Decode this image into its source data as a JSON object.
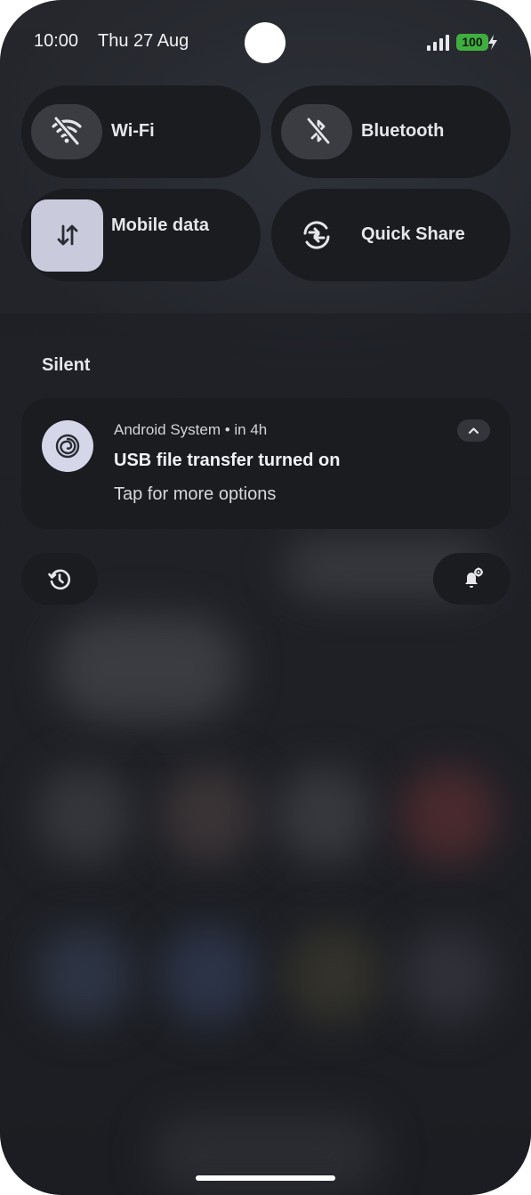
{
  "status_bar": {
    "time": "10:00",
    "date": "Thu 27 Aug",
    "battery": "100",
    "battery_color": "#3fae3f"
  },
  "quick_tiles": {
    "wifi": {
      "label": "Wi-Fi",
      "icon": "wifi-off-icon"
    },
    "bluetooth": {
      "label": "Bluetooth",
      "icon": "bluetooth-off-icon"
    },
    "mobile_data": {
      "label": "Mobile data",
      "icon": "swap-vertical-icon",
      "active": true
    },
    "quick_share": {
      "label": "Quick Share",
      "icon": "quick-share-icon"
    }
  },
  "notifications": {
    "section_label": "Silent",
    "items": [
      {
        "app_icon": "spiral-icon",
        "meta": "Android System • in 4h",
        "title": "USB file transfer turned on",
        "text": "Tap for more options"
      }
    ]
  },
  "actions": {
    "history_icon": "history-icon",
    "notification_settings_icon": "bell-settings-icon"
  },
  "colors": {
    "tile_bg": "#1a1c20",
    "active_tile_bg": "#c9cadc"
  }
}
